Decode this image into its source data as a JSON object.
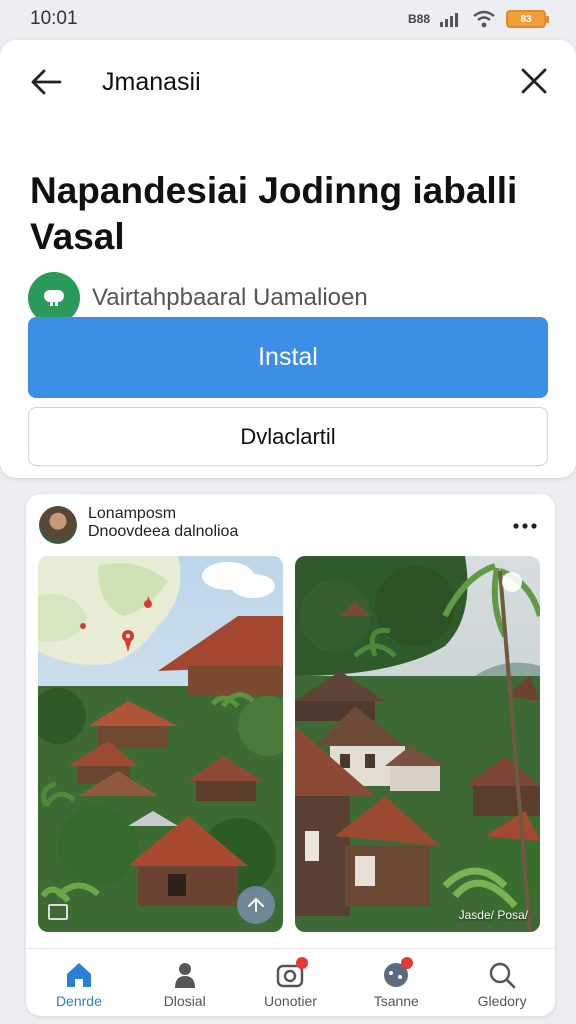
{
  "status_bar": {
    "time": "10:01",
    "network": "B88",
    "battery": "83"
  },
  "header": {
    "title": "Jmanasii"
  },
  "app": {
    "title": "Napandesiai Jodinng iaballi Vasal",
    "developer": "Vairtahpbaaral Uamalioen",
    "install_label": "Instal",
    "secondary_label": "Dvlaclartil"
  },
  "post": {
    "author": "Lonamposm",
    "subtitle": "Dnoovdeea dalnolioa",
    "photo_caption": "Jasde/ Posa/"
  },
  "bottom_nav": {
    "items": [
      {
        "label": "Denrde",
        "icon": "home-icon",
        "active": true
      },
      {
        "label": "Dlosial",
        "icon": "person-icon",
        "active": false
      },
      {
        "label": "Uonotier",
        "icon": "camera-icon",
        "active": false,
        "badge": true
      },
      {
        "label": "Tsanne",
        "icon": "game-icon",
        "active": false,
        "badge": true
      },
      {
        "label": "Gledory",
        "icon": "search-icon",
        "active": false
      }
    ]
  },
  "colors": {
    "install": "#3c8ee6",
    "accent": "#2b7fd8",
    "developer_logo": "#2a9a5a",
    "badge": "#e53935"
  }
}
